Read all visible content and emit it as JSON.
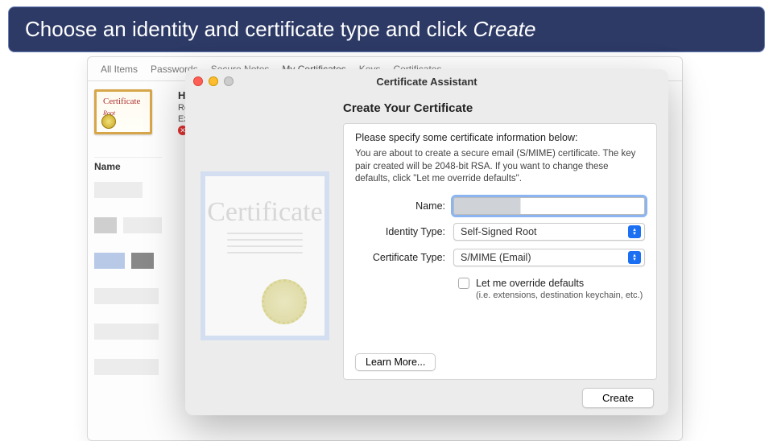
{
  "banner": {
    "text_a": "Choose an identity and certificate type and click ",
    "text_em": "Create"
  },
  "keychain": {
    "tabs": [
      "All Items",
      "Passwords",
      "Secure Notes",
      "My Certificates",
      "Keys",
      "Certificates"
    ],
    "active_tab_index": 3,
    "cert_icon_title": "Certificate",
    "cert_icon_sub": "Root",
    "detail_title": "Ha",
    "detail_line1": "Ro",
    "detail_line2": "Ex",
    "name_col": "Name"
  },
  "modal": {
    "window_title": "Certificate Assistant",
    "heading": "Create Your Certificate",
    "lead": "Please specify some certificate information below:",
    "desc": "You are about to create a secure email (S/MIME) certificate. The key pair created will be 2048-bit RSA. If you want to change these defaults, click \"Let me override defaults\".",
    "name_label": "Name:",
    "name_value": "",
    "identity_label": "Identity Type:",
    "identity_value": "Self-Signed Root",
    "certtype_label": "Certificate Type:",
    "certtype_value": "S/MIME (Email)",
    "override_label": "Let me override defaults",
    "override_hint": "(i.e. extensions, destination keychain, etc.)",
    "learn_more": "Learn More...",
    "create": "Create",
    "watermark": "Certificate"
  }
}
